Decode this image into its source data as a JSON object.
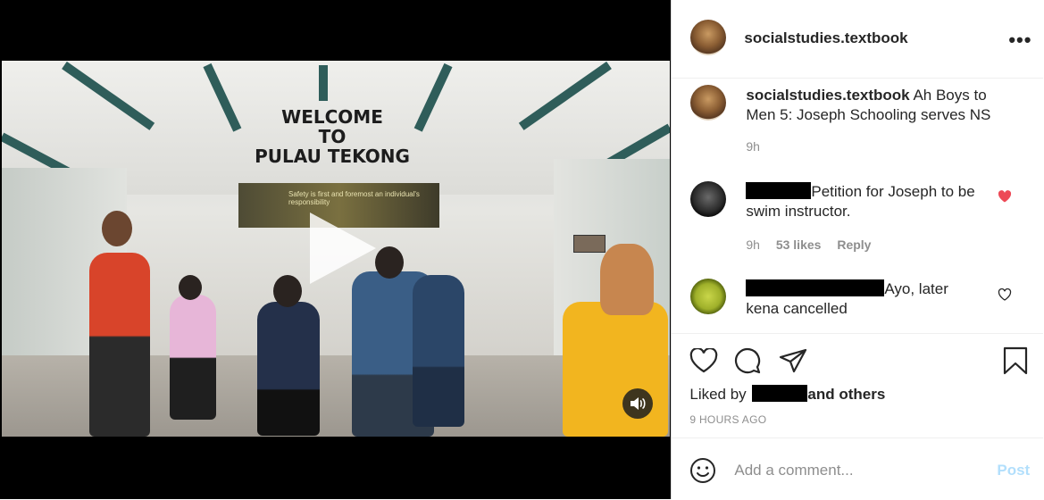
{
  "post": {
    "username": "socialstudies.textbook",
    "caption": "Ah Boys to Men 5: Joseph Schooling serves NS",
    "caption_time": "9h",
    "video": {
      "sign_line1": "WELCOME",
      "sign_line2": "TO",
      "sign_line3": "PULAU TEKONG",
      "banner_text": "Safety is first and foremost an individual's responsibility"
    }
  },
  "comments": [
    {
      "text": "Petition for Joseph to be swim instructor.",
      "time": "9h",
      "likes": "53 likes",
      "reply": "Reply",
      "liked": true,
      "heart_color": "#ed4956"
    },
    {
      "text": "Ayo, later kena cancelled",
      "liked": false
    }
  ],
  "actions": {
    "like_icon": "heart-icon",
    "comment_icon": "comment-icon",
    "share_icon": "share-icon",
    "save_icon": "bookmark-icon"
  },
  "liked_by": {
    "prefix": "Liked by",
    "suffix": "and others"
  },
  "timestamp": "9 HOURS AGO",
  "add_comment": {
    "placeholder": "Add a comment...",
    "post_label": "Post",
    "emoji_icon": "smiley-icon"
  },
  "more_label": "•••"
}
